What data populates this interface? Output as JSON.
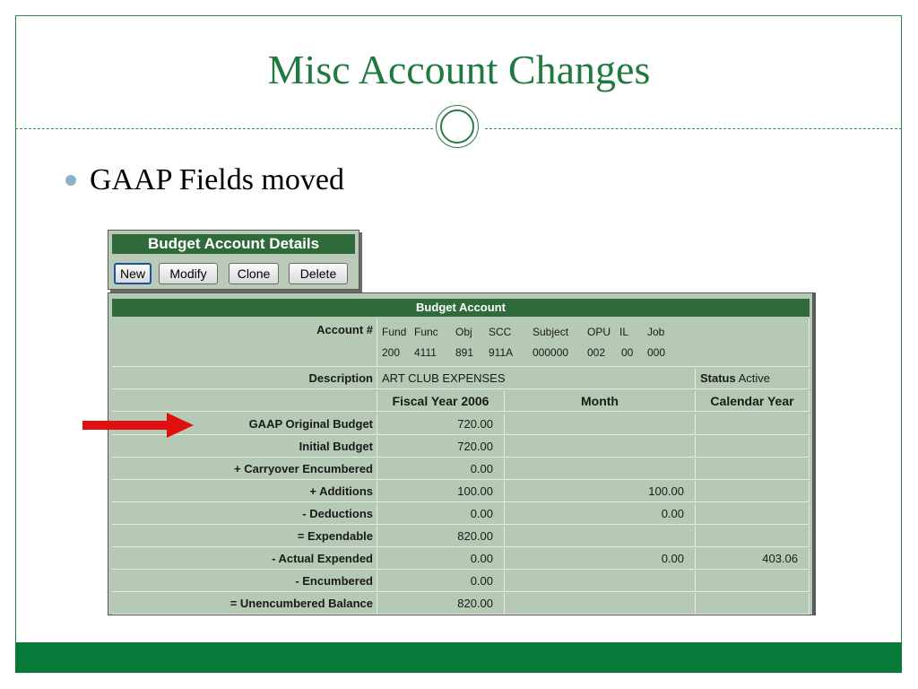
{
  "slide": {
    "title": "Misc Account Changes",
    "bullet": "GAAP Fields moved",
    "colors": {
      "title": "#1e7a3e",
      "footer": "#077a3a",
      "panel_header": "#2f6b3a",
      "panel_bg": "#b6c9b4",
      "arrow": "#e01010"
    }
  },
  "details": {
    "title": "Budget Account Details",
    "buttons": {
      "new": "New",
      "modify": "Modify",
      "clone": "Clone",
      "delete": "Delete"
    }
  },
  "account": {
    "header": "Budget Account",
    "account_label": "Account #",
    "segments": [
      {
        "name": "Fund",
        "value": "200"
      },
      {
        "name": "Func",
        "value": "4111"
      },
      {
        "name": "Obj",
        "value": "891"
      },
      {
        "name": "SCC",
        "value": "911A"
      },
      {
        "name": "Subject",
        "value": "000000"
      },
      {
        "name": "OPU",
        "value": "002"
      },
      {
        "name": "IL",
        "value": "00"
      },
      {
        "name": "Job",
        "value": "000"
      }
    ],
    "description_label": "Description",
    "description": "ART CLUB EXPENSES",
    "status_label": "Status",
    "status": "Active",
    "columns": [
      "Fiscal Year 2006",
      "Month",
      "Calendar Year"
    ],
    "rows": [
      {
        "label": "GAAP Original Budget",
        "fiscal": "720.00",
        "month": "",
        "calendar": ""
      },
      {
        "label": "Initial Budget",
        "fiscal": "720.00",
        "month": "",
        "calendar": ""
      },
      {
        "label": "+ Carryover Encumbered",
        "fiscal": "0.00",
        "month": "",
        "calendar": ""
      },
      {
        "label": "+ Additions",
        "fiscal": "100.00",
        "month": "100.00",
        "calendar": ""
      },
      {
        "label": "- Deductions",
        "fiscal": "0.00",
        "month": "0.00",
        "calendar": ""
      },
      {
        "label": "= Expendable",
        "fiscal": "820.00",
        "month": "",
        "calendar": ""
      },
      {
        "label": "- Actual Expended",
        "fiscal": "0.00",
        "month": "0.00",
        "calendar": "403.06"
      },
      {
        "label": "- Encumbered",
        "fiscal": "0.00",
        "month": "",
        "calendar": ""
      },
      {
        "label": "= Unencumbered Balance",
        "fiscal": "820.00",
        "month": "",
        "calendar": ""
      }
    ]
  }
}
